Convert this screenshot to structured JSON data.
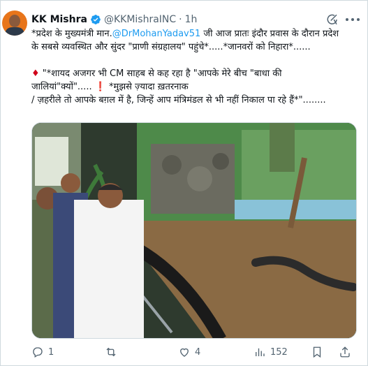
{
  "author": {
    "name": "KK Mishra",
    "handle": "@KKMishraINC",
    "separator": "·",
    "time": "1h"
  },
  "tweet": {
    "line1_pre": "*प्रदेश के मुख्यमंत्री मान.",
    "line1_mention": "@DrMohanYadav51",
    "line1_post": " जी आज प्रातः इंदौर प्रवास के दौरान प्रदेश",
    "line2": "के सबसे व्यवस्थित और सुंदर \"प्राणी संग्रहालय\" पहुंचे*.....*जानवरों को निहारा*......",
    "line3_marker": "♦",
    "line3": " \"*शायद अजगर भी CM साहब से कह रहा है \"आपके मेरे बीच \"बाधा की",
    "line4_pre": "जालियां\"क्यों\"..... ",
    "line4_marker": "❗",
    "line4_post": " *मुझसे ज़्यादा ख़तरनाक",
    "line5": "/ ज़हरीले तो आपके बग़ल में है, जिन्हें आप मंत्रिमंडल से भी नहीं निकाल पा रहे हैं*\"........"
  },
  "actions": {
    "reply_count": "1",
    "retweet_count": "",
    "like_count": "4",
    "views_count": "152"
  }
}
